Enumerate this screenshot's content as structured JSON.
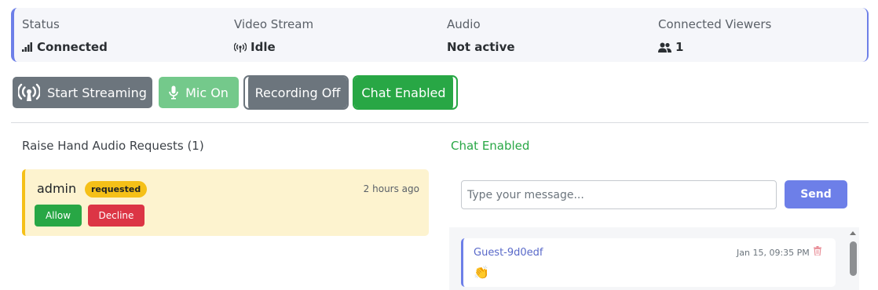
{
  "status": {
    "items": [
      {
        "label": "Status",
        "value": "Connected",
        "icon": "signal-bars-icon"
      },
      {
        "label": "Video Stream",
        "value": "Idle",
        "icon": "broadcast-icon"
      },
      {
        "label": "Audio",
        "value": "Not active",
        "icon": ""
      },
      {
        "label": "Connected Viewers",
        "value": "1",
        "icon": "users-icon"
      }
    ]
  },
  "toolbar": {
    "start_streaming": "Start Streaming",
    "mic": "Mic On",
    "recording": "Recording Off",
    "chat": "Chat Enabled"
  },
  "raise_hand": {
    "title": "Raise Hand Audio Requests (1)",
    "requests": [
      {
        "name": "admin",
        "badge": "requested",
        "time": "2 hours ago",
        "allow_label": "Allow",
        "decline_label": "Decline"
      }
    ]
  },
  "chat": {
    "title": "Chat Enabled",
    "input_placeholder": "Type your message...",
    "send_label": "Send",
    "messages": [
      {
        "sender": "Guest-9d0edf",
        "time": "Jan 15, 09:35 PM",
        "text": "👏"
      }
    ]
  },
  "colors": {
    "accent": "#6d7fe8",
    "success": "#28a745",
    "danger": "#dc3545",
    "warning": "#f5c018",
    "secondary": "#6c757d"
  }
}
